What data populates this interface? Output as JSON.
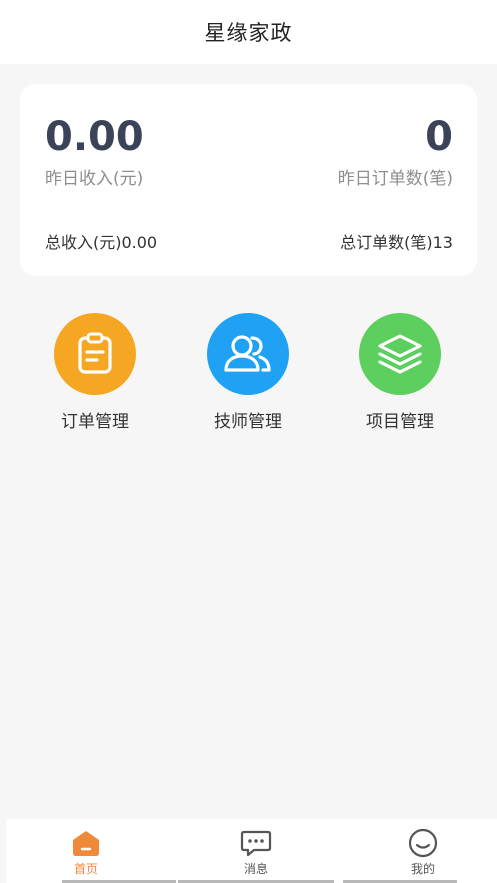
{
  "header": {
    "title": "星缘家政"
  },
  "stats": {
    "yesterday_income_value": "0.00",
    "yesterday_income_label": "昨日收入(元)",
    "yesterday_orders_value": "0",
    "yesterday_orders_label": "昨日订单数(笔)",
    "total_income": "总收入(元)0.00",
    "total_orders": "总订单数(笔)13"
  },
  "menu": [
    {
      "label": "订单管理",
      "icon": "clipboard-icon",
      "color": "#f5a623"
    },
    {
      "label": "技师管理",
      "icon": "users-icon",
      "color": "#1fa2f3"
    },
    {
      "label": "项目管理",
      "icon": "layers-icon",
      "color": "#5ccf5f"
    }
  ],
  "tabbar": [
    {
      "label": "首页",
      "icon": "home-icon",
      "active": true
    },
    {
      "label": "消息",
      "icon": "message-icon",
      "active": false
    },
    {
      "label": "我的",
      "icon": "profile-icon",
      "active": false
    }
  ],
  "colors": {
    "accent": "#f08a3a",
    "value_text": "#3b4358"
  }
}
